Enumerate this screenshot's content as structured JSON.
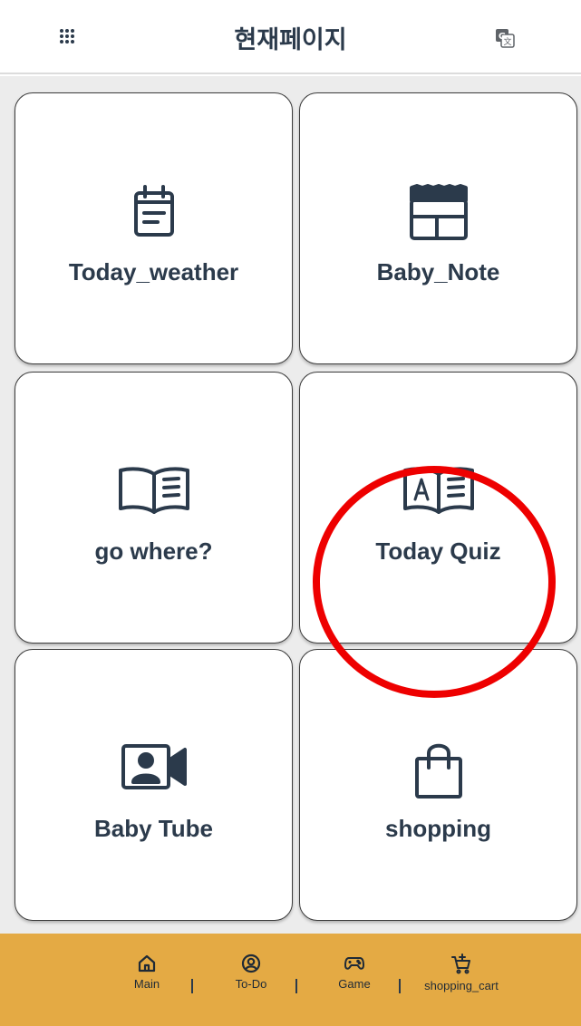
{
  "header": {
    "title": "현재페이지",
    "menu_icon": "apps-grid-icon",
    "translate_icon": "translate-icon"
  },
  "cards": [
    {
      "label": "Today_weather",
      "icon": "calendar-icon"
    },
    {
      "label": "Baby_Note",
      "icon": "layout-table-icon"
    },
    {
      "label": "go where?",
      "icon": "open-book-icon"
    },
    {
      "label": "Today Quiz",
      "icon": "dictionary-icon"
    },
    {
      "label": "Baby Tube",
      "icon": "video-contact-icon"
    },
    {
      "label": "shopping",
      "icon": "shopping-bag-icon"
    }
  ],
  "bottom_nav": {
    "items": [
      {
        "label": "Main",
        "icon": "home-icon"
      },
      {
        "label": "To-Do",
        "icon": "user-circle-icon"
      },
      {
        "label": "Game",
        "icon": "gamepad-icon"
      },
      {
        "label": "shopping_cart",
        "icon": "add-cart-icon"
      }
    ],
    "separator": "|"
  },
  "colors": {
    "text": "#2b3a4b",
    "grid_background": "#ececec",
    "nav_background": "#e4aa44",
    "highlight": "#ee0000"
  }
}
